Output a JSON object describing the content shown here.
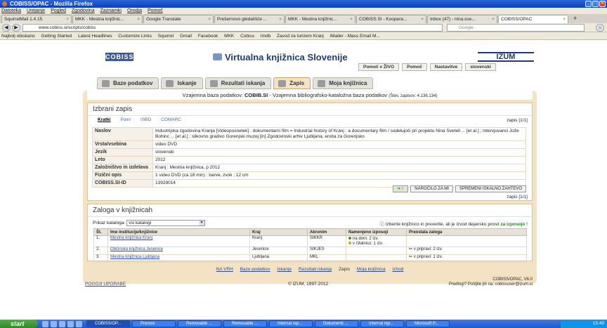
{
  "window": {
    "title": "COBISS/OPAC - Mozilla Firefox"
  },
  "menu": [
    "Datoteka",
    "Urejanje",
    "Pogled",
    "Zgodovina",
    "Zaznamki",
    "Orodja",
    "Pomoč"
  ],
  "tabs": [
    "SquirrelMail 1.4.15",
    "MKK - Mestna knjižnic...",
    "Google Translate",
    "Prešernovo gledališče ...",
    "MKK - Mestna knjižnic...",
    "COBISS.SI - Koopera...",
    "Inbox (47) - nina.sve...",
    "COBISS/OPAC"
  ],
  "url": "www.cobiss.si/scripts/cobiss",
  "search_placeholder": "Google",
  "bookmarks": [
    "Najbolj obiskano",
    "Getting Started",
    "Latest Headlines",
    "Customize Links",
    "Squirrel",
    "Gmail",
    "Facebook",
    "MKK",
    "Cobiss",
    "Imdb",
    "Zavod za turizem Kranj",
    "iMailer - Mass Email M..."
  ],
  "site": {
    "logo": "COBISS",
    "title": "Virtualna knjižnica Slovenije",
    "izum": "IZUM",
    "toplinks": [
      "Pomoč v ŽIVO",
      "Pomoč",
      "Nastavitve",
      "slovenski"
    ],
    "navtabs": [
      "Baze podatkov",
      "Iskanje",
      "Rezultati iskanja",
      "Zapis",
      "Moja knjižnica"
    ],
    "info_prefix": "Vzajemna baza podatkov: ",
    "info_db": "COBIB.SI",
    "info_rest": " - Vzajemna bibliografsko-kataložna baza podatkov ",
    "info_count": "(Štev. zapisov: 4.136.134)"
  },
  "record": {
    "heading": "Izbrani zapis",
    "subtabs": [
      "Kratki",
      "Polni",
      "ISBD",
      "COMARC"
    ],
    "zapis": "zapis [1/1]",
    "rows": [
      {
        "k": "Naslov",
        "v": "Industrijska zgodovina Kranja [Videoposnetek] : dokumentarni film = Industrial history of Kranj : a documentary film / sodelujoči pri projektu Nina Sveteli ... [et al.] ; intervjuvanci Jože Bohinc ... [et al.] ; slikovno gradivo Gorenjski muzej [in] Zgodovinski arhiv Ljubljana, enota za Gorenjsko"
      },
      {
        "k": "Vrsta/vsebina",
        "v": "video DVD"
      },
      {
        "k": "Jezik",
        "v": "slovenski"
      },
      {
        "k": "Leto",
        "v": "2012"
      },
      {
        "k": "Založništvo in izdelava",
        "v": "Kranj : Mestna knjižnica, p 2012"
      },
      {
        "k": "Fizični opis",
        "v": "1 video DVD (ca 18 min) : barve, zvok ; 12 cm"
      },
      {
        "k": "COBISS.SI-ID",
        "v": "13929014"
      }
    ],
    "buttons": [
      "NAROČILO ZA MI",
      "SPREMENI ISKALNO ZAHTEVO"
    ]
  },
  "holdings": {
    "heading": "Zaloga v knjižnicah",
    "kat_label": "Prikaz kataloga:",
    "kat_value": "vsi katalogi",
    "hint_pre": "Izberite knjižnico in preverite, ali je izvod dejansko ",
    "hint_bold": "prost za izposojo",
    "hint_post": " !",
    "cols": [
      "Št.",
      "Ime institucije/knjižnice",
      "Kraj",
      "Akronim",
      "Namenjeno izposoji",
      "Preostala zaloga"
    ],
    "rows": [
      {
        "n": "1.",
        "name": "Mestna knjižnica Kranj",
        "kraj": "Kranj",
        "akr": "SIKKR",
        "nam1": "na dom: 2 izv.",
        "nam2": "v čitalnico: 1 izv.",
        "pre": ""
      },
      {
        "n": "2.",
        "name": "Občinska knjižnica Jesenice",
        "kraj": "Jesenice",
        "akr": "SIKJES",
        "nam1": "",
        "nam2": "",
        "pre": "v pripravi: 2 izv."
      },
      {
        "n": "3.",
        "name": "Mestna knjižnica Ljubljana",
        "kraj": "Ljubljana",
        "akr": "MKL",
        "nam1": "",
        "nam2": "",
        "pre": "v pripravi: 1 izv."
      }
    ]
  },
  "footnav": [
    "NA VRH",
    "Baze podatkov",
    "Iskanje",
    "Rezultati iskanja",
    "Zapis",
    "Moja knjižnica",
    "Izhod"
  ],
  "footer": {
    "left": "POGOJI UPORABE",
    "mid": "© IZUM, 1997-2012",
    "r1": "COBISS/OPAC, V6.0",
    "r2": "Predlogi? Pošljite jih na: cobissuser@izum.si"
  },
  "taskbar": {
    "start": "start",
    "items": [
      "COBISS/OP...",
      "Prenosi",
      "Removable ...",
      "Removable ...",
      "Internal rep...",
      "Dokumenti ...",
      "Internal rep...",
      "Microsoft P..."
    ],
    "clock": "15:40"
  }
}
